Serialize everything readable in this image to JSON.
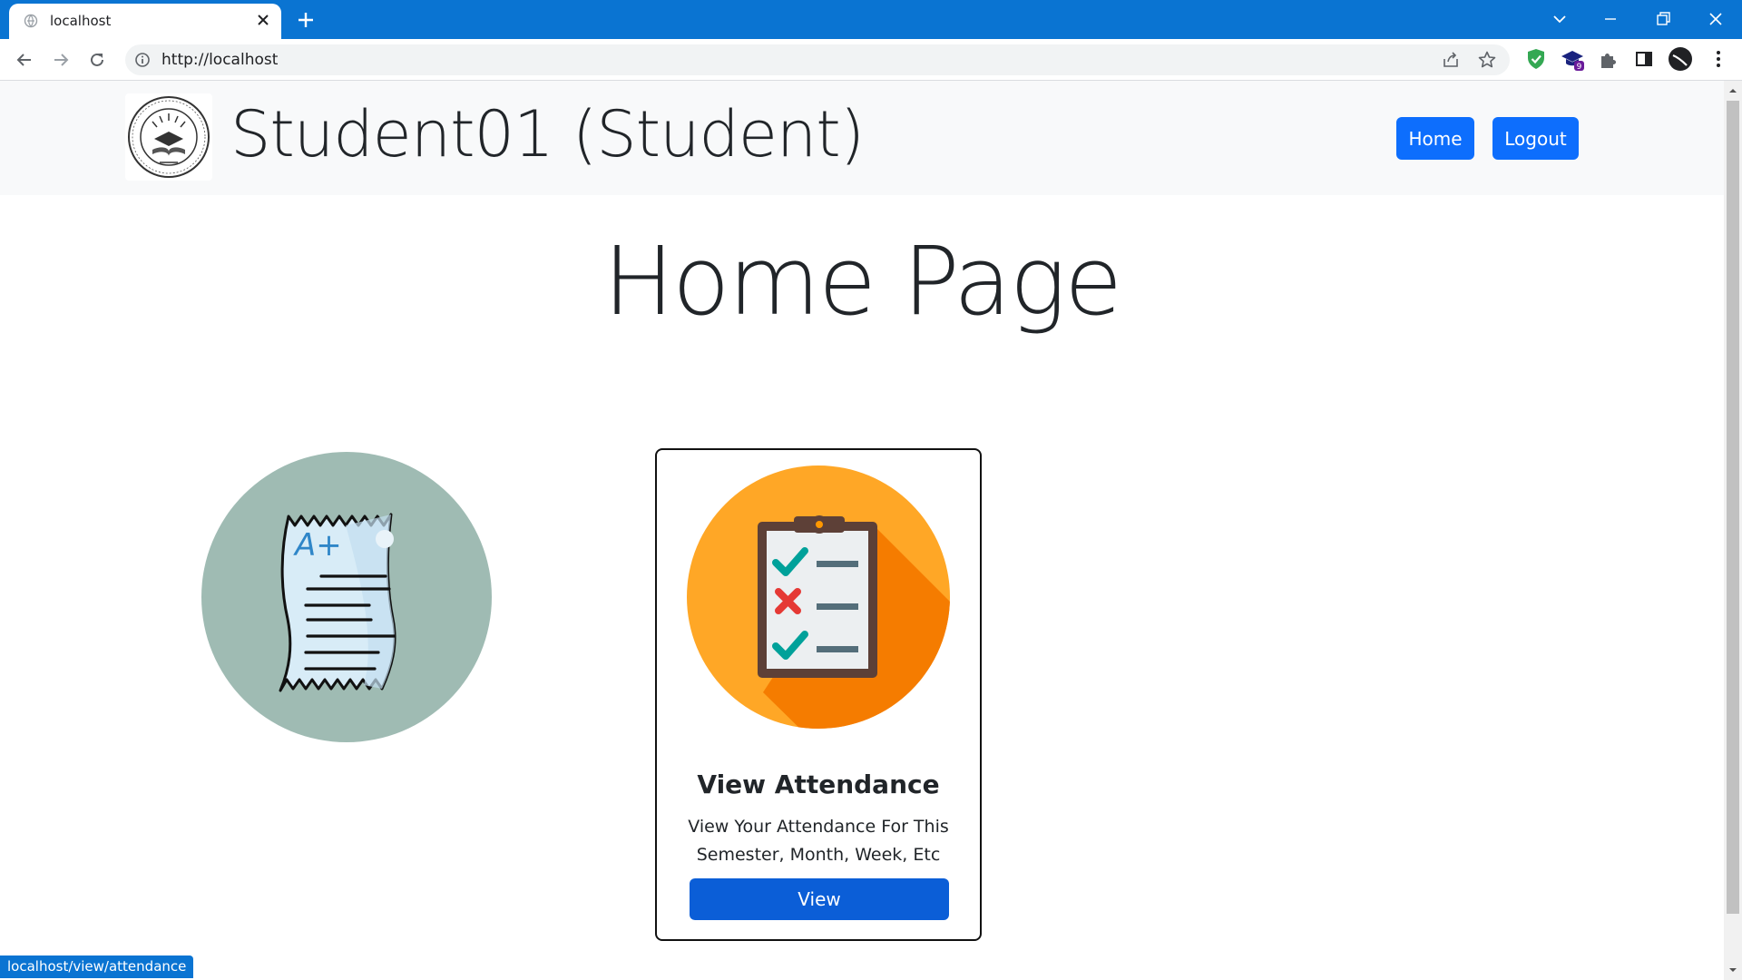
{
  "browser": {
    "tab_title": "localhost",
    "url": "http://localhost",
    "extension_badge": "9",
    "status_url": "localhost/view/attendance"
  },
  "navbar": {
    "brand": "Student01 (Student)",
    "home_label": "Home",
    "logout_label": "Logout",
    "accent": "#0d6efd"
  },
  "main": {
    "title": "Home Page",
    "cards": [
      {
        "icon": "report-card-icon"
      },
      {
        "icon": "attendance-clipboard-icon",
        "title": "View Attendance",
        "text": "View Your Attendance For This Semester, Month, Week, Etc",
        "button_label": "View"
      }
    ]
  }
}
